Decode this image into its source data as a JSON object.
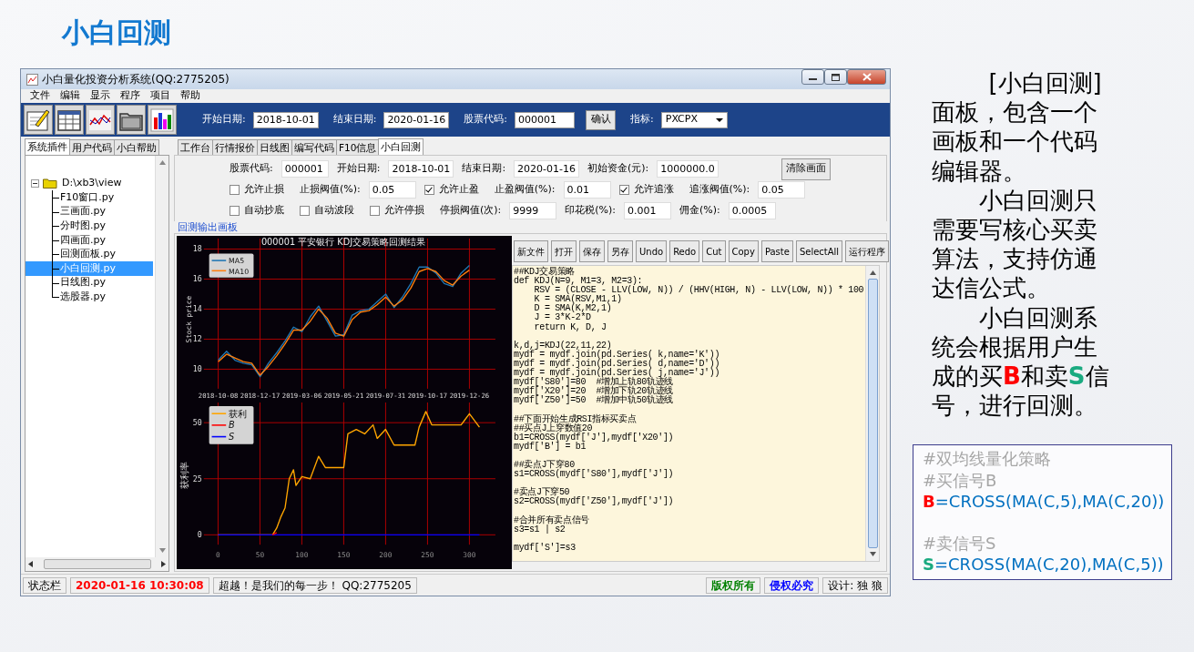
{
  "slide_title": "小白回测",
  "window": {
    "title": "小白量化投资分析系统(QQ:2775205)",
    "menu": [
      "文件",
      "编辑",
      "显示",
      "程序",
      "项目",
      "帮助"
    ],
    "toolbar": [
      {
        "kind": "label",
        "text": "开始日期:"
      },
      {
        "kind": "field",
        "value": "2018-10-01"
      },
      {
        "kind": "label",
        "text": "结束日期:"
      },
      {
        "kind": "field",
        "value": "2020-01-16"
      },
      {
        "kind": "label",
        "text": "股票代码:"
      },
      {
        "kind": "field",
        "value": "000001"
      },
      {
        "kind": "button",
        "text": "确认"
      },
      {
        "kind": "label",
        "text": "指标:"
      },
      {
        "kind": "dropdown",
        "value": "PXCPX"
      }
    ],
    "left_tabs": [
      {
        "label": "系统插件",
        "selected": true
      },
      {
        "label": "用户代码",
        "selected": false
      },
      {
        "label": "小白帮助",
        "selected": false
      }
    ],
    "tree": {
      "label": "D:\\xb3\\view",
      "expanded": true,
      "children": [
        {
          "label": "F10窗口.py",
          "selected": false
        },
        {
          "label": "三画面.py",
          "selected": false
        },
        {
          "label": "分时图.py",
          "selected": false
        },
        {
          "label": "四画面.py",
          "selected": false
        },
        {
          "label": "回测面板.py",
          "selected": false
        },
        {
          "label": "小白回测.py",
          "selected": true
        },
        {
          "label": "日线图.py",
          "selected": false
        },
        {
          "label": "选股器.py",
          "selected": false
        }
      ]
    },
    "tabs": [
      {
        "label": "工作台",
        "selected": false
      },
      {
        "label": "行情报价",
        "selected": false
      },
      {
        "label": "日线图",
        "selected": false
      },
      {
        "label": "编写代码",
        "selected": false
      },
      {
        "label": "F10信息",
        "selected": false
      },
      {
        "label": "小白回测",
        "selected": true
      }
    ],
    "params": [
      [
        {
          "kind": "field",
          "label": "股票代码:",
          "value": "000001"
        },
        {
          "kind": "field",
          "label": "开始日期:",
          "value": "2018-10-01"
        },
        {
          "kind": "field",
          "label": "结束日期:",
          "value": "2020-01-16"
        },
        {
          "kind": "field",
          "label": "初始资金(元):",
          "value": "1000000.0"
        },
        {
          "kind": "button",
          "label": "清除画面"
        }
      ],
      [
        {
          "kind": "checkbox",
          "label": "允许止损",
          "checked": false
        },
        {
          "kind": "field",
          "label": "止损阀值(%):",
          "value": "0.05"
        },
        {
          "kind": "checkbox",
          "label": "允许止盈",
          "checked": true
        },
        {
          "kind": "field",
          "label": "止盈阀值(%):",
          "value": "0.01"
        },
        {
          "kind": "checkbox",
          "label": "允许追涨",
          "checked": true
        },
        {
          "kind": "field",
          "label": "追涨阀值(%):",
          "value": "0.05"
        }
      ],
      [
        {
          "kind": "checkbox",
          "label": "自动抄底",
          "checked": false
        },
        {
          "kind": "checkbox",
          "label": "自动波段",
          "checked": false
        },
        {
          "kind": "checkbox",
          "label": "允许停损",
          "checked": false
        },
        {
          "kind": "field",
          "label": "停损阀值(次):",
          "value": "9999"
        },
        {
          "kind": "field",
          "label": "印花税(%):",
          "value": "0.001"
        },
        {
          "kind": "field",
          "label": "佣金(%):",
          "value": "0.0005"
        }
      ]
    ],
    "output_label": "回测输出画板",
    "charts": [
      {
        "chart_data": {
          "type": "line",
          "title": "000001  平安银行   KDJ交易策略回测结果",
          "ylabel": "Stock price",
          "categories": [
            "2018-10-08",
            null,
            null,
            null,
            null,
            "2018-12-17",
            null,
            null,
            null,
            null,
            "2019-03-06",
            null,
            null,
            null,
            null,
            "2019-05-21",
            null,
            null,
            null,
            null,
            "2019-07-31",
            null,
            null,
            null,
            null,
            "2019-10-17",
            null,
            null,
            null,
            null,
            "2019-12-26"
          ],
          "ylim": [
            8.7,
            18.7
          ],
          "yticks": [
            10,
            12,
            14,
            16,
            18
          ],
          "grid": true,
          "legend": true,
          "series": [
            {
              "name": "MA5",
              "color": "#1f77b4",
              "values": [
                10.6,
                11.2,
                10.6,
                10.4,
                10.3,
                9.5,
                10.4,
                11.1,
                11.9,
                12.8,
                12.5,
                13.5,
                14.2,
                13.2,
                12.2,
                12.3,
                13.6,
                13.9,
                14.0,
                14.5,
                15.0,
                14.1,
                14.8,
                15.7,
                16.8,
                16.8,
                16.4,
                15.7,
                15.5,
                16.4,
                16.9
              ]
            },
            {
              "name": "MA10",
              "color": "#ff7f0e",
              "values": [
                10.5,
                11.0,
                10.75,
                10.5,
                10.4,
                9.6,
                10.2,
                10.9,
                11.7,
                12.6,
                12.6,
                13.2,
                14.0,
                13.4,
                12.4,
                12.2,
                13.3,
                13.8,
                13.9,
                14.3,
                14.8,
                14.2,
                14.6,
                15.4,
                16.5,
                16.7,
                16.5,
                15.9,
                15.6,
                16.2,
                16.6
              ]
            }
          ]
        }
      },
      {
        "chart_data": {
          "type": "line",
          "ylabel": "获利率",
          "x": [
            0,
            65,
            70,
            75,
            80,
            85,
            90,
            93,
            100,
            110,
            120,
            128,
            150,
            155,
            165,
            175,
            185,
            190,
            200,
            210,
            235,
            240,
            248,
            255,
            290,
            300,
            312
          ],
          "xlim": [
            -17,
            331
          ],
          "ylim": [
            -4.4,
            59
          ],
          "xticks": [
            0,
            50,
            100,
            150,
            200,
            250,
            300
          ],
          "yticks": [
            0,
            25,
            50
          ],
          "grid": true,
          "legend": true,
          "series": [
            {
              "name": "获利",
              "color": "#ffa500",
              "values": [
                0,
                0,
                3,
                8,
                12,
                25,
                29,
                22,
                26,
                25,
                35,
                30,
                30,
                45,
                47,
                45,
                49,
                43,
                47,
                40,
                40,
                48,
                55,
                49,
                49,
                54,
                48
              ]
            },
            {
              "name": "B",
              "color": "#ff0000",
              "values": [
                null,
                0,
                1,
                null,
                null,
                null,
                null,
                null,
                null,
                null,
                null,
                null,
                null,
                null,
                null,
                null,
                null,
                null,
                null,
                null,
                null,
                null,
                null,
                null,
                null,
                null,
                null
              ]
            },
            {
              "name": "S",
              "color": "#0000ff",
              "values": [
                0,
                0,
                0,
                0,
                0,
                0,
                0,
                0,
                0,
                0,
                0,
                0,
                0,
                0,
                0,
                0,
                0,
                0,
                0,
                0,
                0,
                0,
                0,
                0,
                0,
                0,
                0
              ]
            }
          ]
        }
      }
    ],
    "editor_buttons": [
      "新文件",
      "打开",
      "保存",
      "另存",
      "Undo",
      "Redo",
      "Cut",
      "Copy",
      "Paste",
      "SelectAll",
      "运行程序"
    ],
    "code": "##KDJ交易策略\ndef KDJ(N=9, M1=3, M2=3):\n    RSV = (CLOSE - LLV(LOW, N)) / (HHV(HIGH, N) - LLV(LOW, N)) * 100\n    K = SMA(RSV,M1,1)\n    D = SMA(K,M2,1)\n    J = 3*K-2*D\n    return K, D, J\n\nk,d,j=KDJ(22,11,22)\nmydf = mydf.join(pd.Series( k,name='K'))\nmydf = mydf.join(pd.Series( d,name='D'))\nmydf = mydf.join(pd.Series( j,name='J'))\nmydf['S80']=80  #增加上轨80轨迹线\nmydf['X20']=20  #增加下轨20轨迹线\nmydf['Z50']=50  #增加中轨50轨迹线\n\n##下面开始生成RSI指标买卖点\n##买点J上穿数值20\nb1=CROSS(mydf['J'],mydf['X20'])\nmydf['B'] = b1\n\n##卖点J下穿80\ns1=CROSS(mydf['S80'],mydf['J'])\n\n#卖点J下穿50\ns2=CROSS(mydf['Z50'],mydf['J'])\n\n#合并所有卖点信号\ns3=s1 | s2\n\nmydf['S']=s3",
    "status_bar": [
      {
        "text": "状态栏"
      },
      {
        "text": "2020-01-16  10:30:08",
        "color": "#ff0000"
      },
      {
        "text": "超越！是我们的每一步！  QQ:2775205"
      },
      {
        "text": "版权所有",
        "color": "#008000"
      },
      {
        "text": "侵权必究",
        "color": "#0000ff"
      },
      {
        "text": "设计: 独 狼"
      }
    ]
  },
  "description": [
    {
      "heading": "[小白回测]",
      "segments": [
        {
          "text": "面板，包含一个画板和一个代码编辑器。"
        }
      ]
    },
    {
      "segments": [
        {
          "text": "小白回测只需要写核心买卖算法，支持仿通达信公式。"
        }
      ]
    },
    {
      "segments": [
        {
          "text": "小白回测系统会根据用户生成的买"
        },
        {
          "text": "B",
          "color": "#ff0000"
        },
        {
          "text": "和卖"
        },
        {
          "text": "S",
          "color": "#1aaa80"
        },
        {
          "text": "信号，进行回测。"
        }
      ]
    }
  ],
  "formula_box": [
    {
      "kind": "comment",
      "text": "#双均线量化策略"
    },
    {
      "kind": "comment",
      "text": "#买信号B"
    },
    {
      "kind": "code",
      "signal": "B",
      "color": "#ff0000",
      "text": "=CROSS(MA(C,5),MA(C,20))"
    },
    {
      "kind": "blank"
    },
    {
      "kind": "comment",
      "text": "#卖信号S"
    },
    {
      "kind": "code",
      "signal": "S",
      "color": "#1aaa80",
      "text": "=CROSS(MA(C,20),MA(C,5))"
    }
  ]
}
